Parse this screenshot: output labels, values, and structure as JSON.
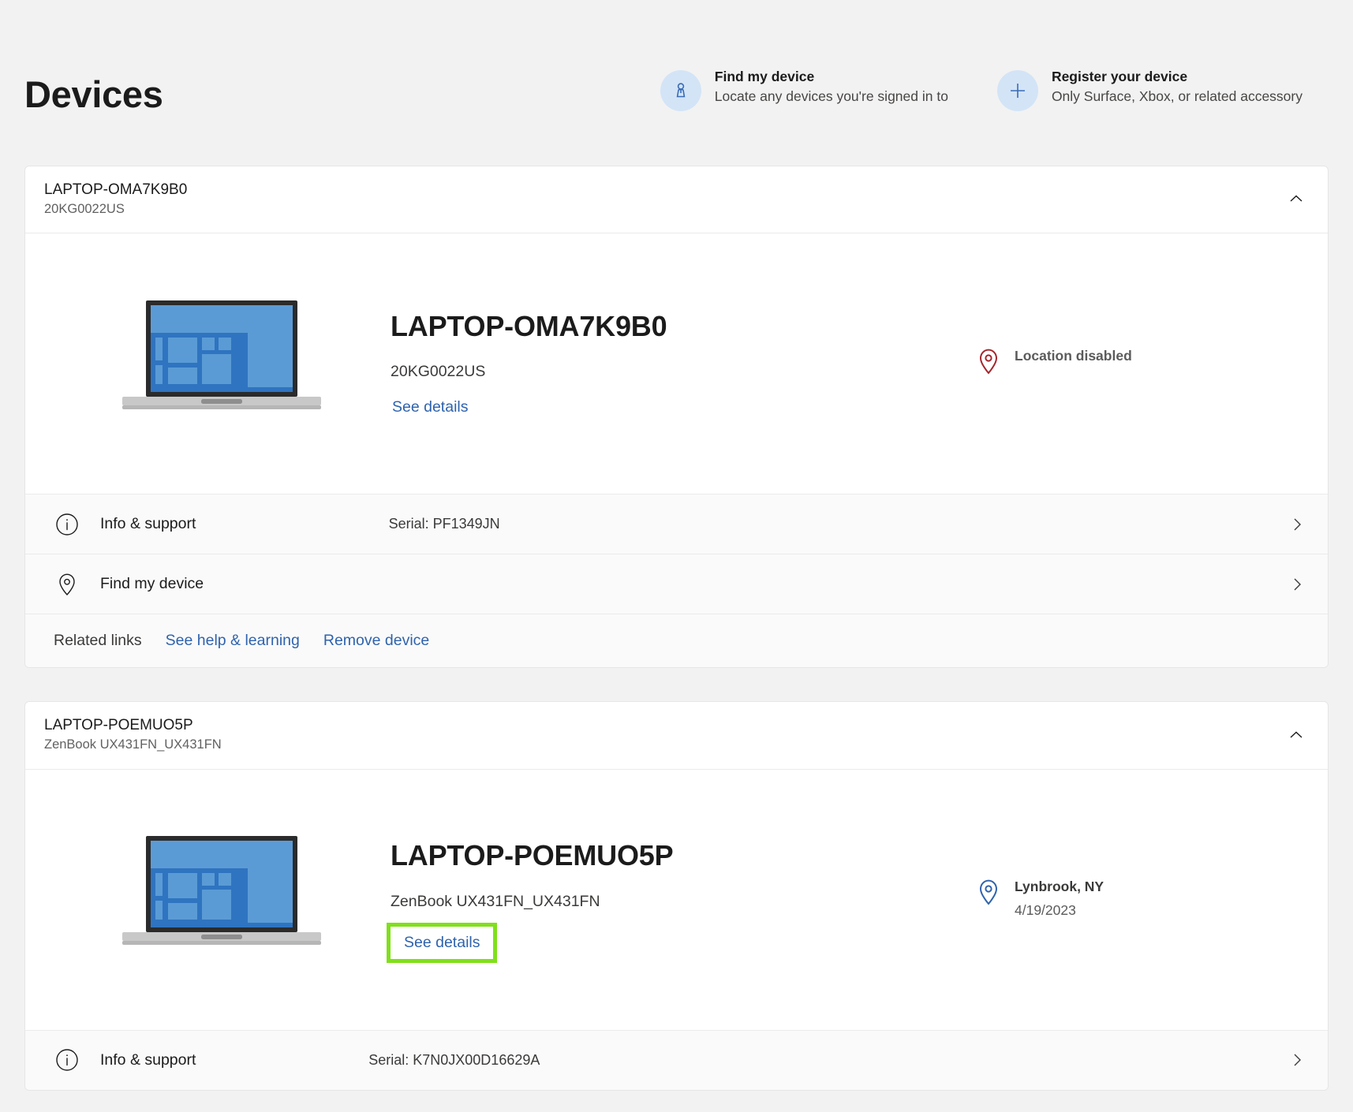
{
  "header": {
    "title": "Devices",
    "actions": [
      {
        "icon": "find-my-device-icon",
        "title": "Find my device",
        "subtitle": "Locate any devices you're signed in to"
      },
      {
        "icon": "plus-icon",
        "title": "Register your device",
        "subtitle": "Only Surface, Xbox, or related accessory"
      }
    ]
  },
  "colors": {
    "page_bg": "#f2f2f2",
    "card_bg": "#ffffff",
    "link": "#2f63ad",
    "accent_circle": "#d3e4f7",
    "location_disabled": "#a4262c",
    "location_enabled": "#2f63ad",
    "highlight": "#80e01a",
    "laptop_screen": "#5b9bd5",
    "laptop_frame": "#2b2b2b",
    "laptop_base": "#c8c8c8"
  },
  "devices": [
    {
      "header_name": "LAPTOP-OMA7K9B0",
      "header_model": "20KG0022US",
      "collapse_icon": "chevron-up-icon",
      "name": "LAPTOP-OMA7K9B0",
      "model": "20KG0022US",
      "see_details_label": "See details",
      "see_details_highlighted": false,
      "status": {
        "icon": "location-pin-disabled-icon",
        "title": "Location disabled",
        "subtitle": "",
        "state": "disabled"
      },
      "rows": [
        {
          "icon": "info-icon",
          "label": "Info & support",
          "value": "Serial: PF1349JN",
          "chevron": "chevron-right-icon"
        },
        {
          "icon": "location-pin-icon",
          "label": "Find my device",
          "value": "",
          "chevron": "chevron-right-icon"
        }
      ],
      "related": {
        "label": "Related links",
        "links": [
          "See help & learning",
          "Remove device"
        ]
      }
    },
    {
      "header_name": "LAPTOP-POEMUO5P",
      "header_model": "ZenBook UX431FN_UX431FN",
      "collapse_icon": "chevron-up-icon",
      "name": "LAPTOP-POEMUO5P",
      "model": "ZenBook UX431FN_UX431FN",
      "see_details_label": "See details",
      "see_details_highlighted": true,
      "status": {
        "icon": "location-pin-icon",
        "title": "Lynbrook, NY",
        "subtitle": "4/19/2023",
        "state": "enabled"
      },
      "rows": [
        {
          "icon": "info-icon",
          "label": "Info & support",
          "value": "Serial: K7N0JX00D16629A",
          "chevron": "chevron-right-icon"
        }
      ],
      "related": null
    }
  ]
}
